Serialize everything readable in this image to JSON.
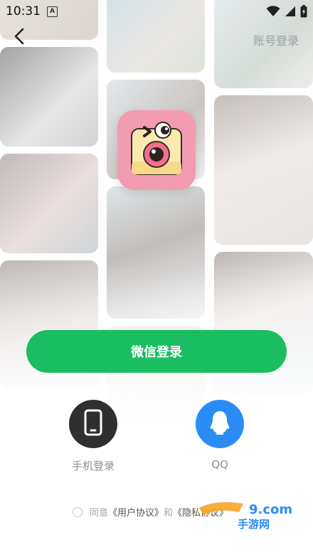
{
  "status_bar": {
    "time": "10:31",
    "notification_badge": "A",
    "icons": [
      "wifi-icon",
      "signal-icon",
      "battery-icon"
    ]
  },
  "nav": {
    "back_icon": "chevron-left-icon",
    "account_login_label": "账号登录"
  },
  "app_logo": {
    "icon": "camera-face-logo",
    "color": "#f39bb0"
  },
  "primary_login": {
    "label": "微信登录",
    "color": "#19be60"
  },
  "alt_logins": {
    "phone": {
      "label": "手机登录",
      "icon": "phone-icon",
      "color": "#2f2f2f"
    },
    "qq": {
      "label": "QQ",
      "icon": "qq-penguin-icon",
      "color": "#2b8cf6"
    }
  },
  "agreement": {
    "prefix": "同意",
    "user_agreement": "《用户协议》",
    "connector": "和",
    "privacy_policy": "《隐私协议》"
  },
  "watermark": {
    "text_top": "9.com",
    "text_bottom": "手游网"
  }
}
